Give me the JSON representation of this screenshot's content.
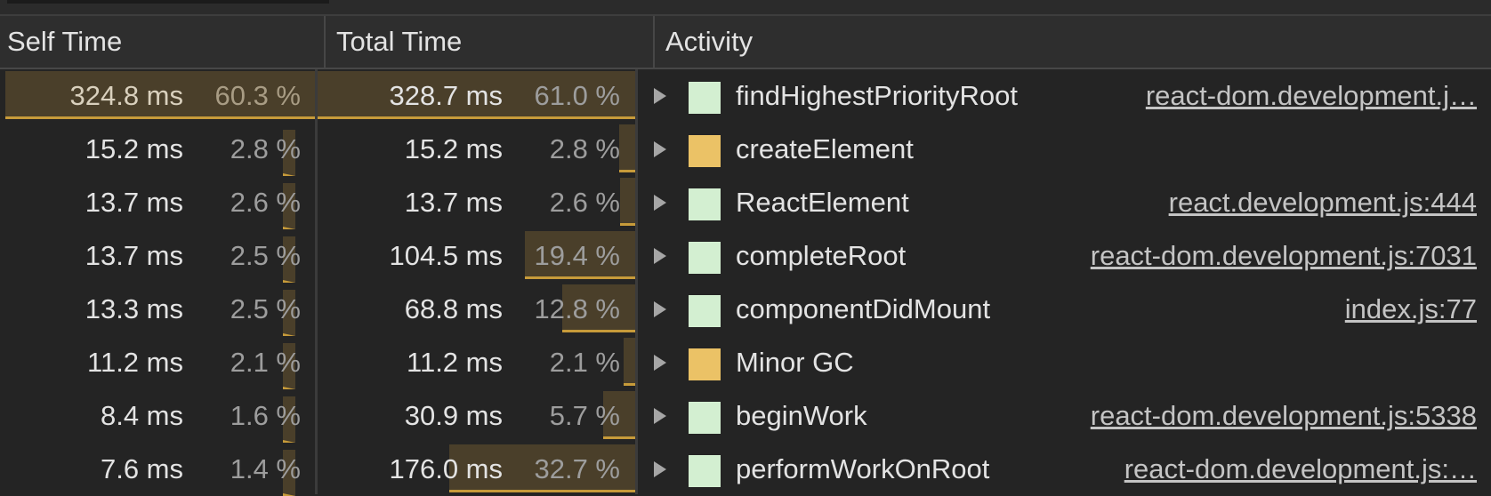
{
  "columns": {
    "self": "Self Time",
    "total": "Total Time",
    "activity": "Activity"
  },
  "colors": {
    "script": "#d3efd1",
    "gc": "#ebc266",
    "bar_fill": "#4a3f2a",
    "bar_line": "#c79b3a"
  },
  "rows": [
    {
      "self_ms": "324.8 ms",
      "self_pct": "60.3 %",
      "self_frac": 0.603,
      "total_ms": "328.7 ms",
      "total_pct": "61.0 %",
      "total_frac": 0.61,
      "name": "findHighestPriorityRoot",
      "source": "react-dom.development.j…",
      "kind": "script",
      "selected": true
    },
    {
      "self_ms": "15.2 ms",
      "self_pct": "2.8 %",
      "self_frac": 0.028,
      "total_ms": "15.2 ms",
      "total_pct": "2.8 %",
      "total_frac": 0.028,
      "name": "createElement",
      "source": "",
      "kind": "gc",
      "selected": false
    },
    {
      "self_ms": "13.7 ms",
      "self_pct": "2.6 %",
      "self_frac": 0.026,
      "total_ms": "13.7 ms",
      "total_pct": "2.6 %",
      "total_frac": 0.026,
      "name": "ReactElement",
      "source": "react.development.js:444",
      "kind": "script",
      "selected": false
    },
    {
      "self_ms": "13.7 ms",
      "self_pct": "2.5 %",
      "self_frac": 0.025,
      "total_ms": "104.5 ms",
      "total_pct": "19.4 %",
      "total_frac": 0.194,
      "name": "completeRoot",
      "source": "react-dom.development.js:7031",
      "kind": "script",
      "selected": false
    },
    {
      "self_ms": "13.3 ms",
      "self_pct": "2.5 %",
      "self_frac": 0.025,
      "total_ms": "68.8 ms",
      "total_pct": "12.8 %",
      "total_frac": 0.128,
      "name": "componentDidMount",
      "source": "index.js:77",
      "kind": "script",
      "selected": false
    },
    {
      "self_ms": "11.2 ms",
      "self_pct": "2.1 %",
      "self_frac": 0.021,
      "total_ms": "11.2 ms",
      "total_pct": "2.1 %",
      "total_frac": 0.021,
      "name": "Minor GC",
      "source": "",
      "kind": "gc",
      "selected": false
    },
    {
      "self_ms": "8.4 ms",
      "self_pct": "1.6 %",
      "self_frac": 0.016,
      "total_ms": "30.9 ms",
      "total_pct": "5.7 %",
      "total_frac": 0.057,
      "name": "beginWork",
      "source": "react-dom.development.js:5338",
      "kind": "script",
      "selected": false
    },
    {
      "self_ms": "7.6 ms",
      "self_pct": "1.4 %",
      "self_frac": 0.014,
      "total_ms": "176.0 ms",
      "total_pct": "32.7 %",
      "total_frac": 0.327,
      "name": "performWorkOnRoot",
      "source": "react-dom.development.js:…",
      "kind": "script",
      "selected": false
    }
  ]
}
